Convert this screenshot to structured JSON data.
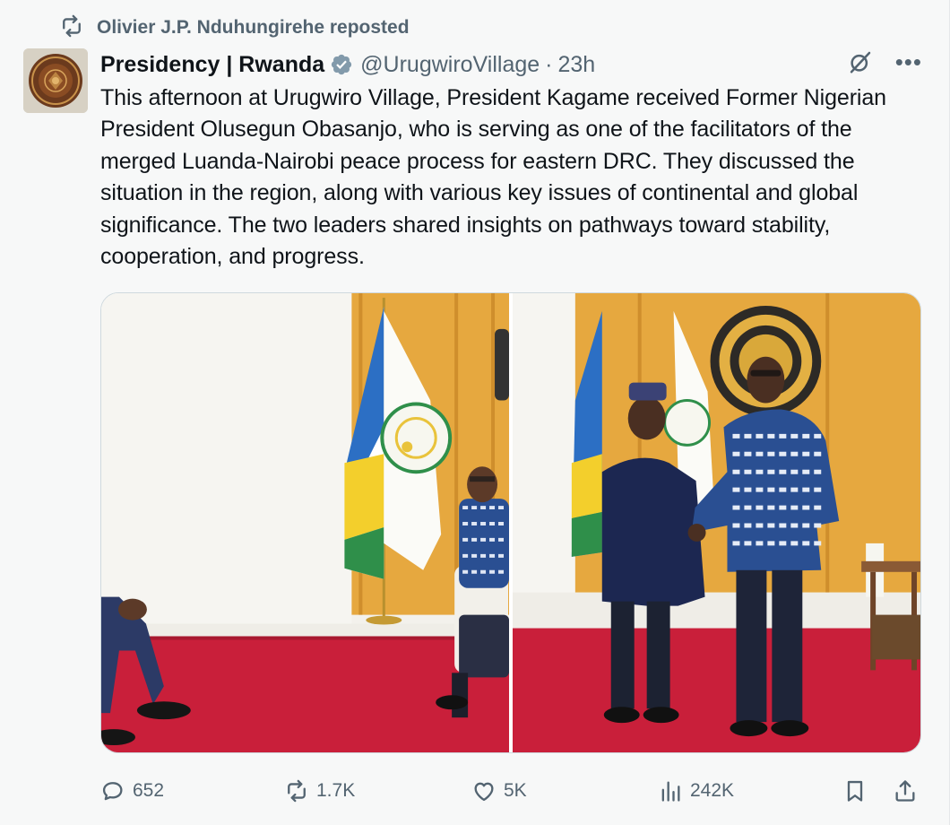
{
  "repost": {
    "text": "Olivier J.P. Nduhungirehe reposted",
    "icon": "repost-icon"
  },
  "post": {
    "author_name": "Presidency | Rwanda",
    "handle": "@UrugwiroVillage",
    "separator": "·",
    "time": "23h",
    "verified": true,
    "text": "This afternoon at Urugwiro Village, President Kagame received Former Nigerian President Olusegun Obasanjo, who is serving as one of the facilitators of the merged Luanda-Nairobi peace process for eastern DRC. They discussed the situation in the region, along with various key issues of continental and global significance. The two leaders shared insights on pathways toward stability, cooperation, and progress."
  },
  "media": {
    "photos": [
      {
        "scene": "two men seated beside Rwandan flag and presidential flag"
      },
      {
        "scene": "two men shaking hands in front of Rwandan seal and flags"
      }
    ]
  },
  "actions": {
    "replies": "652",
    "reposts": "1.7K",
    "likes": "5K",
    "views": "242K"
  },
  "colors": {
    "background": "#f7f8f8",
    "text": "#0f1419",
    "muted": "#536471",
    "verified": "#829aab"
  }
}
